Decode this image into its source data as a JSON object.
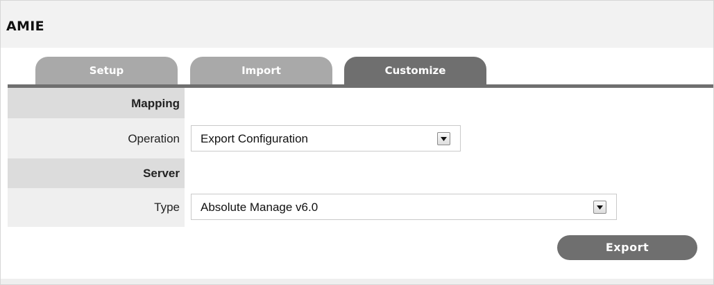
{
  "window": {
    "title": "AMIE"
  },
  "tabs": [
    {
      "label": "Setup",
      "active": false
    },
    {
      "label": "Import",
      "active": false
    },
    {
      "label": "Customize",
      "active": true
    }
  ],
  "form": {
    "mapping_section": "Mapping",
    "operation": {
      "label": "Operation",
      "value": "Export Configuration"
    },
    "server_section": "Server",
    "type": {
      "label": "Type",
      "value": "Absolute Manage v6.0"
    },
    "export_label": "Export"
  },
  "icons": {
    "dropdown": "chevron-down-icon"
  },
  "colors": {
    "tab_active": "#6f6f6f",
    "tab_inactive": "#a9a9a9",
    "section_bg": "#dcdcdc",
    "label_bg": "#efefef",
    "header_bg": "#f2f2f2",
    "button_bg": "#6f6f6f"
  }
}
